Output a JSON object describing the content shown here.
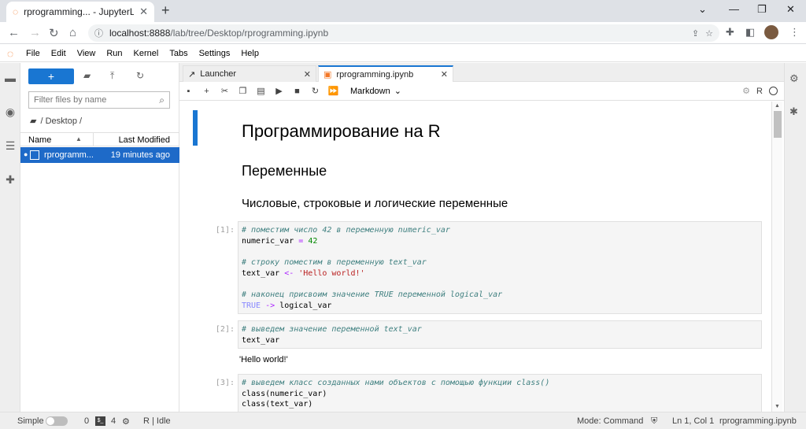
{
  "browser": {
    "tab_title": "rprogramming... - JupyterLab",
    "tab_close": "✕",
    "new_tab": "+",
    "window_controls": [
      "⌄",
      "—",
      "❐",
      "✕"
    ],
    "url_host": "localhost:8888",
    "url_path": "/lab/tree/Desktop/rprogramming.ipynb"
  },
  "menubar": {
    "items": [
      "File",
      "Edit",
      "View",
      "Run",
      "Kernel",
      "Tabs",
      "Settings",
      "Help"
    ]
  },
  "filebrowser": {
    "new_label": "+",
    "filter_placeholder": "Filter files by name",
    "breadcrumb": "/ Desktop /",
    "col_name": "Name",
    "col_modified": "Last Modified",
    "files": [
      {
        "name": "rprogramm...",
        "modified": "19 minutes ago"
      }
    ]
  },
  "doctabs": [
    {
      "label": "Launcher",
      "active": false
    },
    {
      "label": "rprogramming.ipynb",
      "active": true
    }
  ],
  "nbtoolbar": {
    "cell_type": "Markdown",
    "kernel_name": "R"
  },
  "notebook": {
    "h1": "Программирование на R",
    "h2": "Переменные",
    "h3": "Числовые, строковые и логические переменные",
    "cells": [
      {
        "prompt": "[1]:"
      },
      {
        "prompt": "[2]:"
      },
      {
        "prompt": "[3]:"
      }
    ],
    "output2": "'Hello world!'"
  },
  "statusbar": {
    "mode_label": "Simple",
    "count0": "0",
    "count4": "4",
    "kernel_status": "R | Idle",
    "mode": "Mode: Command",
    "position": "Ln 1, Col 1",
    "filename": "rprogramming.ipynb"
  },
  "colors": {
    "accent": "#1976d2",
    "selected_row": "#1e6ac8",
    "jupyter_orange": "#f37726"
  }
}
